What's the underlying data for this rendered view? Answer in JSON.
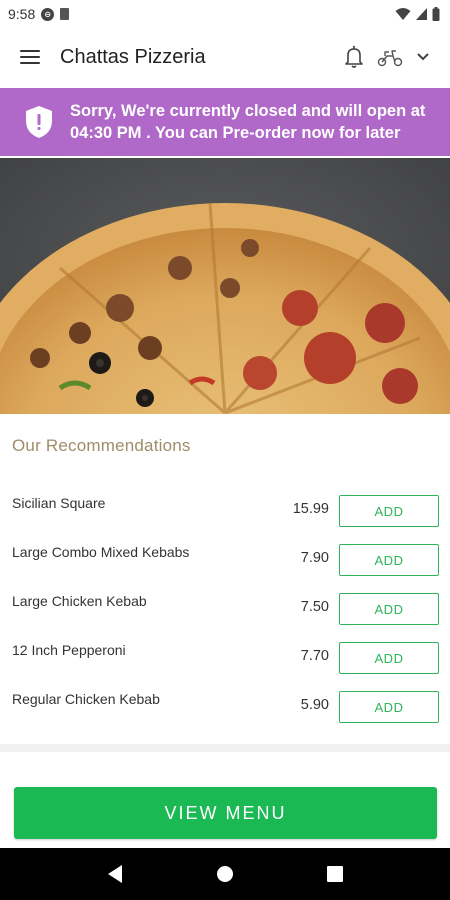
{
  "status_bar": {
    "time": "9:58"
  },
  "app_bar": {
    "title": "Chattas Pizzeria"
  },
  "banner": {
    "line1": "Sorry, We're currently closed and will open at",
    "line2": "04:30 PM . You can Pre-order now for later",
    "color": "#b069c8"
  },
  "recommendations": {
    "title": "Our Recommendations",
    "items": [
      {
        "name": "Sicilian Square",
        "price": "15.99",
        "action": "ADD"
      },
      {
        "name": "Large Combo Mixed Kebabs",
        "price": "7.90",
        "action": "ADD"
      },
      {
        "name": "Large Chicken Kebab",
        "price": "7.50",
        "action": "ADD"
      },
      {
        "name": "12 Inch Pepperoni",
        "price": "7.70",
        "action": "ADD"
      },
      {
        "name": "Regular Chicken Kebab",
        "price": "5.90",
        "action": "ADD"
      }
    ]
  },
  "footer": {
    "view_menu_label": "VIEW MENU",
    "accent": "#1bb954"
  },
  "icons": {
    "menu": "hamburger-icon",
    "bell": "bell-icon",
    "mode": "scooter-icon",
    "chevron": "chevron-down-icon",
    "banner": "shield-alert-icon",
    "nav_back": "back-triangle-icon",
    "nav_home": "home-circle-icon",
    "nav_recents": "recents-square-icon"
  }
}
